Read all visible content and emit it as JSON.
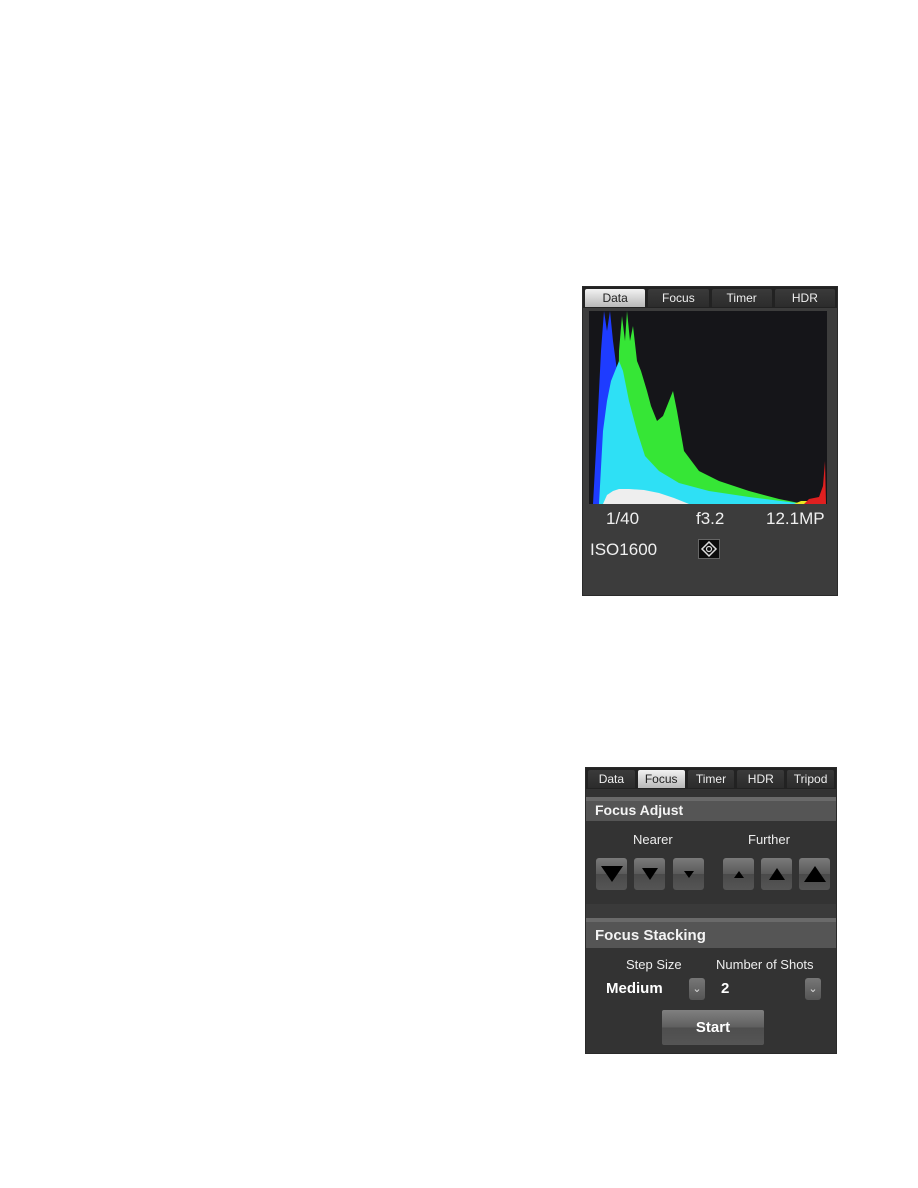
{
  "data_panel": {
    "tabs": [
      {
        "label": "Data",
        "active": true
      },
      {
        "label": "Focus"
      },
      {
        "label": "Timer"
      },
      {
        "label": "HDR"
      }
    ],
    "histogram": {
      "channels": [
        "blue",
        "cyan",
        "green",
        "white",
        "red"
      ],
      "colors": {
        "blue": "#1e3cff",
        "cyan": "#2ee0f5",
        "green": "#36e636",
        "white": "#eeeeee",
        "red": "#e02020",
        "yellow": "#e8e820"
      }
    },
    "shutter": "1/40",
    "aperture": "f3.2",
    "resolution": "12.1MP",
    "iso": "ISO1600",
    "focus_mode_icon": "focus-point-icon"
  },
  "focus_panel": {
    "tabs": [
      {
        "label": "Data"
      },
      {
        "label": "Focus",
        "active": true
      },
      {
        "label": "Timer"
      },
      {
        "label": "HDR"
      },
      {
        "label": "Tripod"
      }
    ],
    "focus_adjust": {
      "title": "Focus Adjust",
      "nearer_label": "Nearer",
      "further_label": "Further"
    },
    "focus_stacking": {
      "title": "Focus Stacking",
      "step_size_label": "Step Size",
      "step_size_value": "Medium",
      "shots_label": "Number of Shots",
      "shots_value": "2",
      "dropdown_glyph": "⌄",
      "start_label": "Start"
    }
  }
}
